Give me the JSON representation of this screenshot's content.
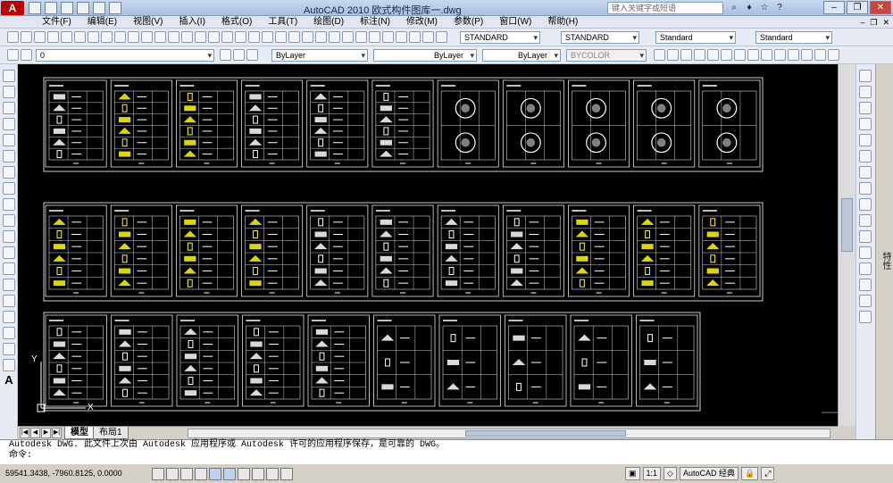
{
  "title_bar": {
    "app_button": "A",
    "title": "AutoCAD 2010      欧式构件图库一.dwg",
    "search_placeholder": "键入关键字或短语",
    "window_controls": [
      "minimize",
      "restore",
      "close"
    ]
  },
  "menubar": {
    "items": [
      "文件(F)",
      "编辑(E)",
      "视图(V)",
      "插入(I)",
      "格式(O)",
      "工具(T)",
      "绘图(D)",
      "标注(N)",
      "修改(M)",
      "参数(P)",
      "窗口(W)",
      "帮助(H)"
    ]
  },
  "toolbar1": {
    "text_style": "STANDARD",
    "dim_style": "STANDARD",
    "table_style": "Standard",
    "multileader_style": "Standard"
  },
  "toolbar2": {
    "layer": "0",
    "color": "ByLayer",
    "linetype": "ByLayer",
    "lineweight": "ByLayer",
    "plot_style": "BYCOLOR"
  },
  "left_tools": [
    "line-icon",
    "construction-line-icon",
    "polyline-icon",
    "polygon-icon",
    "rectangle-icon",
    "arc-icon",
    "circle-icon",
    "revcloud-icon",
    "spline-icon",
    "ellipse-icon",
    "ellipse-arc-icon",
    "insert-block-icon",
    "make-block-icon",
    "point-icon",
    "hatch-icon",
    "gradient-icon",
    "region-icon",
    "table-icon",
    "mtext-icon"
  ],
  "left_text_tool": "A",
  "right_tools": [
    "erase-icon",
    "copy-icon",
    "mirror-icon",
    "offset-icon",
    "array-icon",
    "move-icon",
    "rotate-icon",
    "scale-icon",
    "stretch-icon",
    "trim-icon",
    "extend-icon",
    "break-icon",
    "join-icon",
    "chamfer-icon",
    "fillet-icon",
    "explode-icon"
  ],
  "properties_palette_label": "特性",
  "ucs": {
    "y": "Y",
    "x": "X"
  },
  "tabs": [
    "模型",
    "布局1"
  ],
  "command_line": {
    "history": "Autodesk DWG.  此文件上次由 Autodesk 应用程序或 Autodesk 许可的应用程序保存，是可靠的 DWG。",
    "prompt": "命令:"
  },
  "status_bar": {
    "coordinates": "59541.3438, -7960.8125, 0.0000",
    "annotation_scale": "1:1",
    "workspace": "AutoCAD 经典"
  },
  "colors": {
    "canvas": "#000000",
    "linework": "#ffffff",
    "highlight": "#ffff00"
  }
}
